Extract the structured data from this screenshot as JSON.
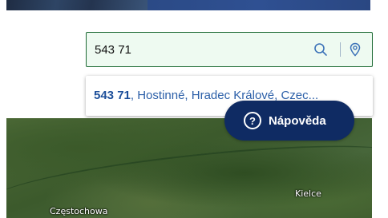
{
  "search": {
    "value": "543 71",
    "search_icon": "search-icon",
    "location_icon": "location-pin-icon"
  },
  "suggestions": [
    {
      "highlight": "543 71",
      "rest": ", Hostinné, Hradec Králové, Czec..."
    }
  ],
  "help": {
    "label": "Nápověda",
    "icon_glyph": "?"
  },
  "map": {
    "labels": {
      "czestochowa": "Częstochowa",
      "kielce": "Kielce"
    }
  },
  "colors": {
    "accent_navy": "#0f2b63",
    "search_border": "#1e6b35",
    "suggestion_text": "#2b5fa8"
  }
}
